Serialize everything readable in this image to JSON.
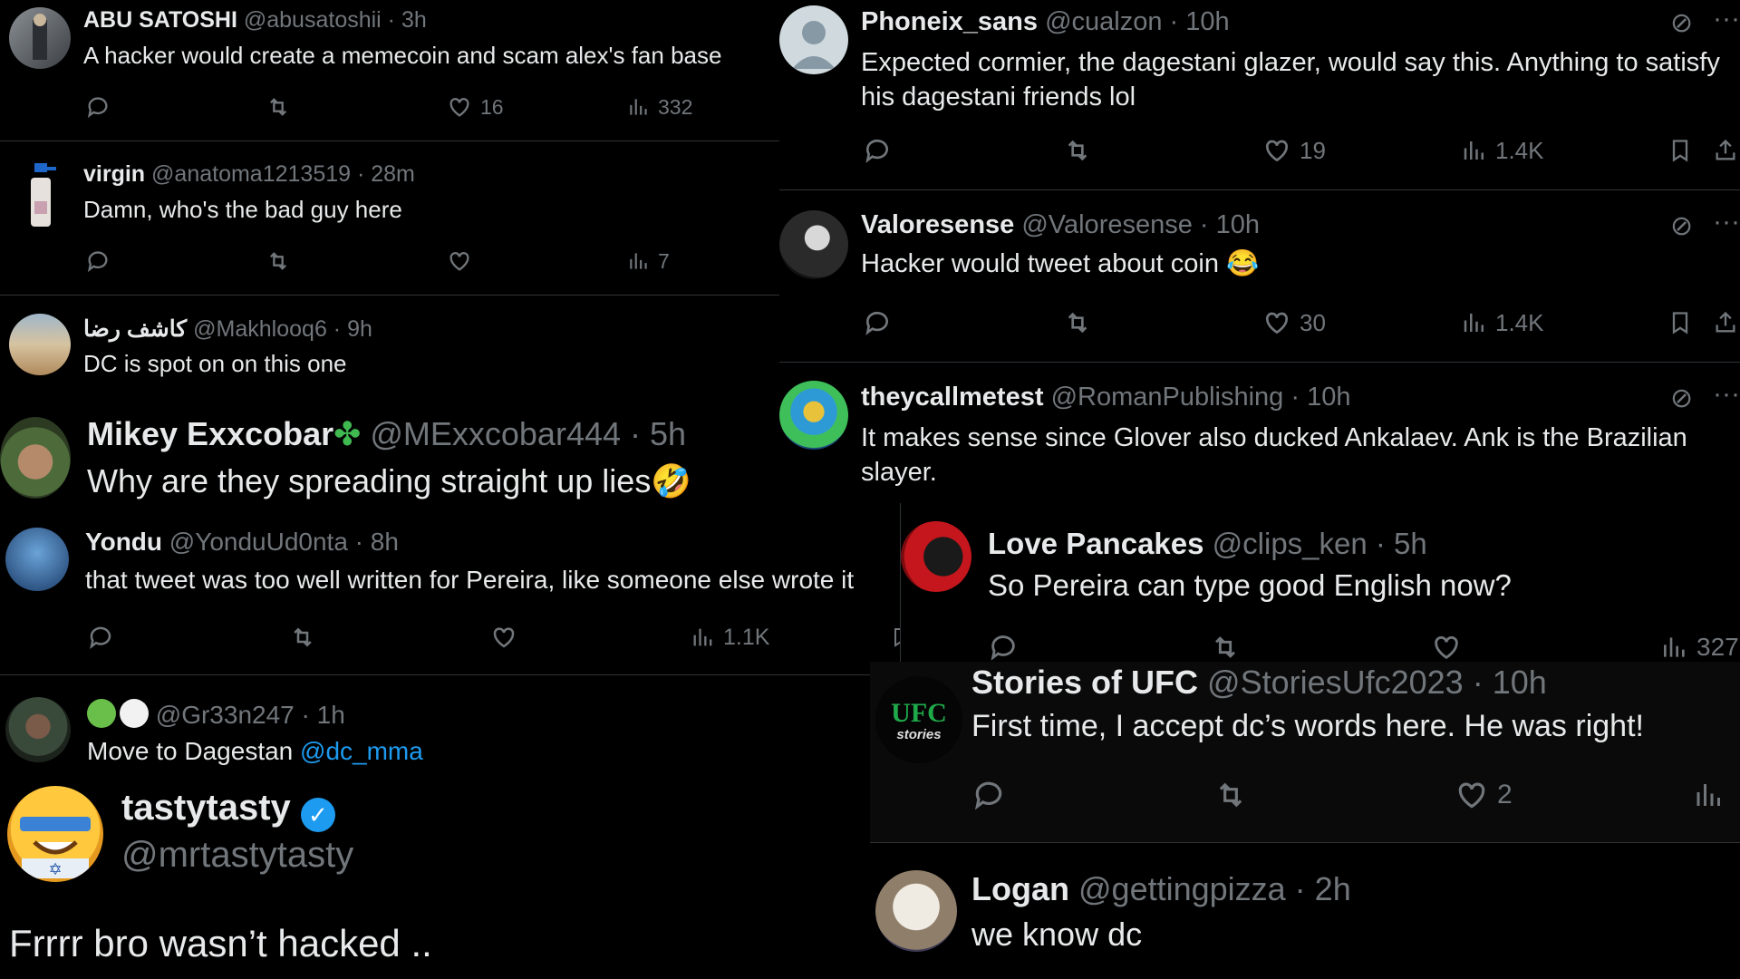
{
  "tweets": {
    "t1": {
      "name": "ABU SATOSHI",
      "handle": "@abusatoshii · 3h",
      "text": "A hacker would create a memecoin and scam alex's fan base",
      "likes": "16",
      "views": "332",
      "avatar": "man-photo-avatar"
    },
    "t2": {
      "name": "virgin",
      "handle": "@anatoma1213519 · 28m",
      "text": "Damn, who's the bad guy here",
      "views": "7",
      "avatar": "spray-bottle-avatar"
    },
    "t3": {
      "name": "كاشف رضا",
      "handle": "@Makhlooq6 · 9h",
      "text": "DC is spot on on this one",
      "avatar": "desert-landscape-avatar"
    },
    "t4": {
      "name": "Mikey Exxcobar",
      "handle": "@MExxcobar444 · 5h",
      "text": "Why are they spreading straight up lies",
      "emoji": "🤣",
      "avatar": "headdress-avatar"
    },
    "t5": {
      "name": "Yondu",
      "handle": "@YonduUd0nta · 8h",
      "text": "that tweet was too well written for Pereira, like someone else wrote it",
      "views": "1.1K",
      "avatar": "blue-character-avatar"
    },
    "t6": {
      "name": "",
      "handle": "@Gr33n247 · 1h",
      "text_prefix": "Move to Dagestan ",
      "mention": "@dc_mma",
      "avatar": "basketball-player-avatar"
    },
    "t7": {
      "name": "tastytasty",
      "handle": "@mrtastytasty",
      "text": "Frrrr bro wasn’t hacked ..",
      "avatar": "smiley-face-avatar"
    },
    "t8": {
      "name": "Phoneix_sans",
      "handle": "@cualzon · 10h",
      "text": "Expected cormier, the dagestani glazer, would say this. Anything to satisfy his dagestani friends lol",
      "likes": "19",
      "views": "1.4K",
      "avatar": "default-avatar"
    },
    "t9": {
      "name": "Valoresense",
      "handle": "@Valoresense · 10h",
      "text": "Hacker would tweet about coin",
      "emoji": "😂",
      "likes": "30",
      "views": "1.4K",
      "avatar": "man-portrait-avatar"
    },
    "t10": {
      "name": "theycallmetest",
      "handle": "@RomanPublishing · 10h",
      "text": "It makes sense since Glover also ducked Ankalaev. Ank is the Brazilian slayer.",
      "avatar": "colorful-character-avatar"
    },
    "t11": {
      "name": "Love Pancakes",
      "handle": "@clips_ken · 5h",
      "text": "So Pereira can type good English now?",
      "views": "327",
      "avatar": "anime-red-avatar"
    },
    "t12": {
      "name": "Stories of UFC",
      "handle": "@StoriesUfc2023 · 10h",
      "text": "First time, I accept dc’s words here. He was right!",
      "likes": "2",
      "logo_top": "UFC",
      "logo_bottom": "stories",
      "avatar": "ufc-stories-logo"
    },
    "t13": {
      "name": "Logan",
      "handle": "@gettingpizza · 2h",
      "text": "we know dc",
      "avatar": "dog-avatar"
    }
  },
  "colors": {
    "background": "#000000",
    "text": "#e7e9ea",
    "muted": "#71767b",
    "link": "#1d9bf0",
    "verified": "#1d9bf0",
    "divider": "#2f3336"
  }
}
